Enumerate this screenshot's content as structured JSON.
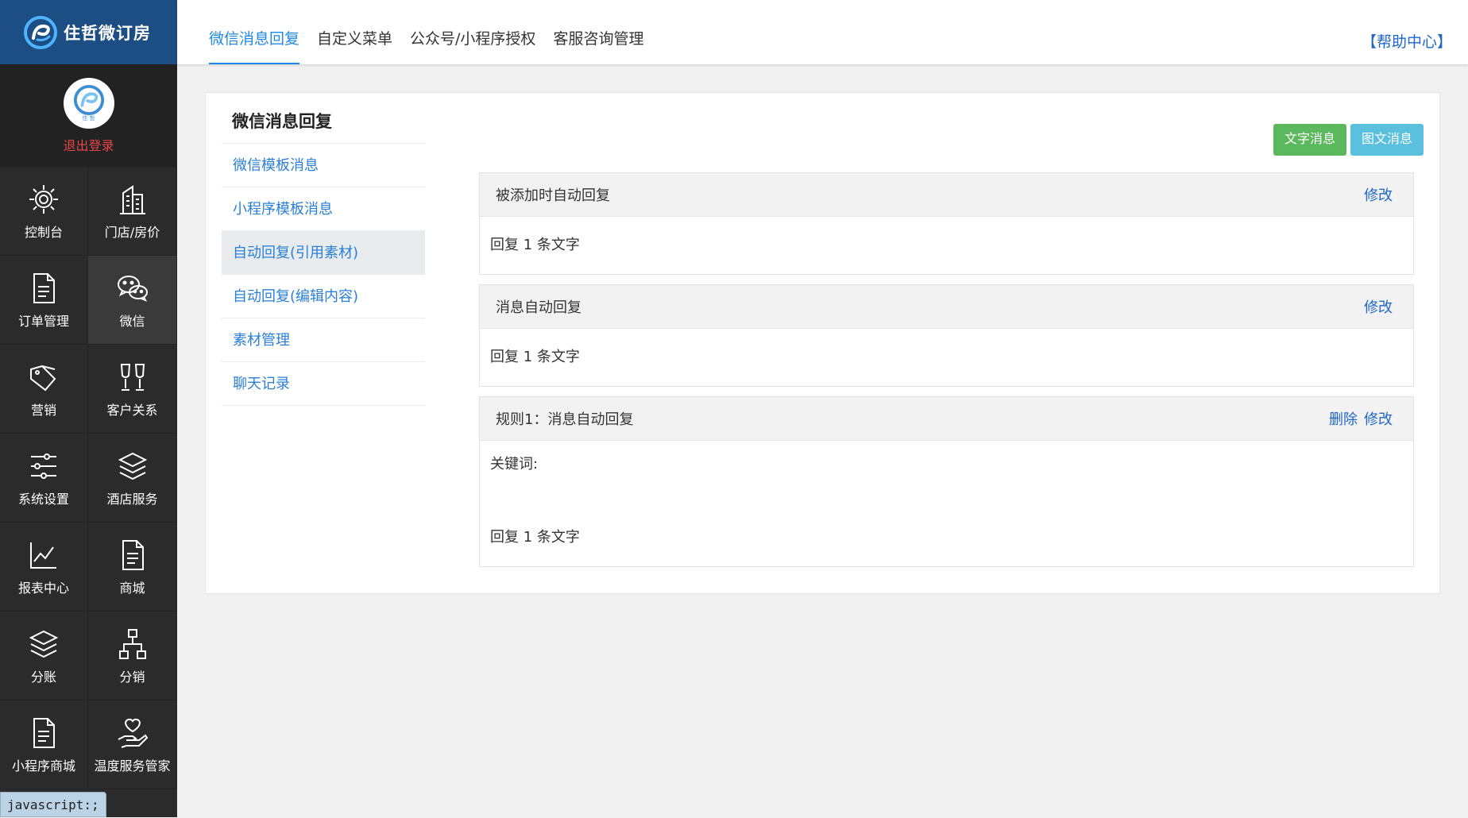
{
  "brand": {
    "name": "住哲微订房",
    "avatar_sub": "住 哲",
    "logout": "退出登录"
  },
  "nav": [
    {
      "label": "控制台",
      "icon": "gear-icon"
    },
    {
      "label": "门店/房价",
      "icon": "buildings-icon"
    },
    {
      "label": "订单管理",
      "icon": "document-icon"
    },
    {
      "label": "微信",
      "icon": "wechat-icon",
      "active": true
    },
    {
      "label": "营销",
      "icon": "tags-icon"
    },
    {
      "label": "客户关系",
      "icon": "glasses-toast-icon"
    },
    {
      "label": "系统设置",
      "icon": "sliders-icon"
    },
    {
      "label": "酒店服务",
      "icon": "layers-icon"
    },
    {
      "label": "报表中心",
      "icon": "line-chart-icon"
    },
    {
      "label": "商城",
      "icon": "document-icon"
    },
    {
      "label": "分账",
      "icon": "layers-icon"
    },
    {
      "label": "分销",
      "icon": "org-chart-icon"
    },
    {
      "label": "小程序商城",
      "icon": "document-icon"
    },
    {
      "label": "温度服务管家",
      "icon": "heart-hand-icon"
    }
  ],
  "status_tip": "javascript:;",
  "top_tabs": [
    {
      "label": "微信消息回复",
      "active": true
    },
    {
      "label": "自定义菜单"
    },
    {
      "label": "公众号/小程序授权"
    },
    {
      "label": "客服咨询管理"
    }
  ],
  "help": "【帮助中心】",
  "subnav": {
    "title": "微信消息回复",
    "items": [
      {
        "label": "微信模板消息"
      },
      {
        "label": "小程序模板消息"
      },
      {
        "label": "自动回复(引用素材)",
        "active": true
      },
      {
        "label": "自动回复(编辑内容)"
      },
      {
        "label": "素材管理"
      },
      {
        "label": "聊天记录"
      }
    ]
  },
  "buttons": {
    "text_msg": "文字消息",
    "news_msg": "图文消息"
  },
  "panels": [
    {
      "title": "被添加时自动回复",
      "edit": "修改",
      "reply": "回复 1 条文字"
    },
    {
      "title": "消息自动回复",
      "edit": "修改",
      "reply": "回复 1 条文字"
    },
    {
      "title": "规则1：消息自动回复",
      "delete": "删除",
      "edit": "修改",
      "keyword": "关键词:",
      "reply": "回复 1 条文字"
    }
  ]
}
